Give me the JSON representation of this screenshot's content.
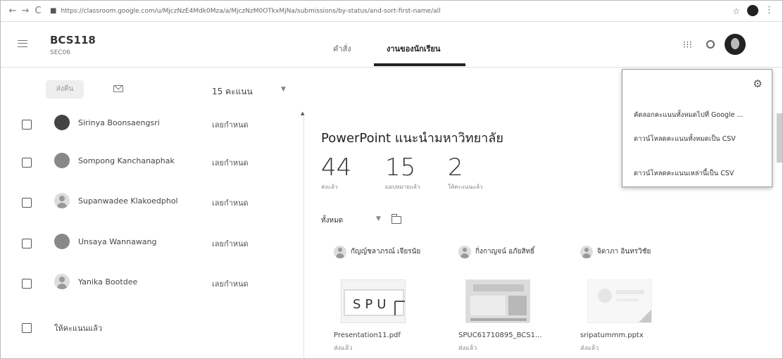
{
  "browser": {
    "url": "https://classroom.google.com/u/MjczNzE4Mdk0Mza/a/MjczNzM0OTkxMjNa/submissions/by-status/and-sort-first-name/all"
  },
  "header": {
    "class_title": "BCS118",
    "class_section": "SEC06",
    "tabs": [
      {
        "label": "คำสั่ง",
        "active": false
      },
      {
        "label": "งานของนักเรียน",
        "active": true
      }
    ]
  },
  "toolbar": {
    "return_label": "ส่งคืน",
    "points_value": "15 คะแนน"
  },
  "students": [
    {
      "name": "Sirinya Boonsaengsri",
      "status": "เลยกำหนด",
      "avatar": "photo"
    },
    {
      "name": "Sompong Kanchanaphak",
      "status": "เลยกำหนด",
      "avatar": "photo"
    },
    {
      "name": "Supanwadee Klakoedphol",
      "status": "เลยกำหนด",
      "avatar": "generic"
    },
    {
      "name": "Unsaya Wannawang",
      "status": "เลยกำหนด",
      "avatar": "photo"
    },
    {
      "name": "Yanika Bootdee",
      "status": "เลยกำหนด",
      "avatar": "generic"
    }
  ],
  "graded_section_label": "ให้คะแนนแล้ว",
  "assignment": {
    "title": "PowerPoint แนะนำมหาวิทยาลัย",
    "stats": [
      {
        "value": "44",
        "label": "ส่งแล้ว"
      },
      {
        "value": "15",
        "label": "มอบหมายแล้ว"
      },
      {
        "value": "2",
        "label": "ให้คะแนนแล้ว"
      }
    ],
    "filter": "ทั้งหมด"
  },
  "submissions": [
    {
      "student": "กัญญ์ชลาภรณ์ เจียรนัย",
      "file": "Presentation11.pdf",
      "status": "ส่งแล้ว"
    },
    {
      "student": "กิ่งกาญจน์ อภัยสิทธิ์",
      "file": "SPUC61710895_BCS1...",
      "status": "ส่งแล้ว"
    },
    {
      "student": "จิดาภา อินทรวิชัย",
      "file": "sripatummm.pptx",
      "status": "ส่งแล้ว"
    }
  ],
  "gear_menu": {
    "items": [
      "คัดลอกคะแนนทั้งหมดไปที่ Google ...",
      "ดาวน์โหลดคะแนนทั้งหมดเป็น CSV",
      "ดาวน์โหลดคะแนนเหล่านี้เป็น CSV"
    ]
  },
  "icons": {
    "back": "arrow-left-icon",
    "forward": "arrow-right-icon",
    "reload": "reload-icon",
    "lock": "lock-icon",
    "star": "star-icon",
    "menu": "hamburger-icon",
    "apps": "apps-grid-icon",
    "notifications": "bell-icon",
    "mail": "mail-icon",
    "folder": "folder-icon",
    "settings": "gear-icon"
  }
}
